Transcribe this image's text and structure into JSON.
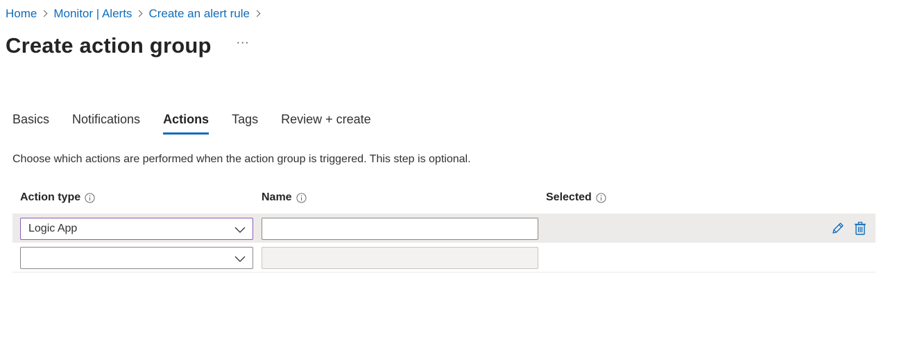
{
  "breadcrumb": {
    "items": [
      "Home",
      "Monitor | Alerts",
      "Create an alert rule"
    ]
  },
  "page": {
    "title": "Create action group",
    "more_label": "···"
  },
  "tabs": [
    {
      "label": "Basics",
      "active": false
    },
    {
      "label": "Notifications",
      "active": false
    },
    {
      "label": "Actions",
      "active": true
    },
    {
      "label": "Tags",
      "active": false
    },
    {
      "label": "Review + create",
      "active": false
    }
  ],
  "description": "Choose which actions are performed when the action group is triggered. This step is optional.",
  "table": {
    "columns": {
      "action_type": "Action type",
      "name": "Name",
      "selected": "Selected"
    },
    "rows": [
      {
        "action_type": "Logic App",
        "name": "",
        "selected": "",
        "icons": [
          "edit-icon",
          "delete-icon"
        ]
      },
      {
        "action_type": "",
        "name": "",
        "selected": "",
        "icons": []
      }
    ]
  },
  "colors": {
    "accent": "#0f6cbd",
    "row_highlight": "#edebe9",
    "focus_border": "#8a5bb8"
  }
}
